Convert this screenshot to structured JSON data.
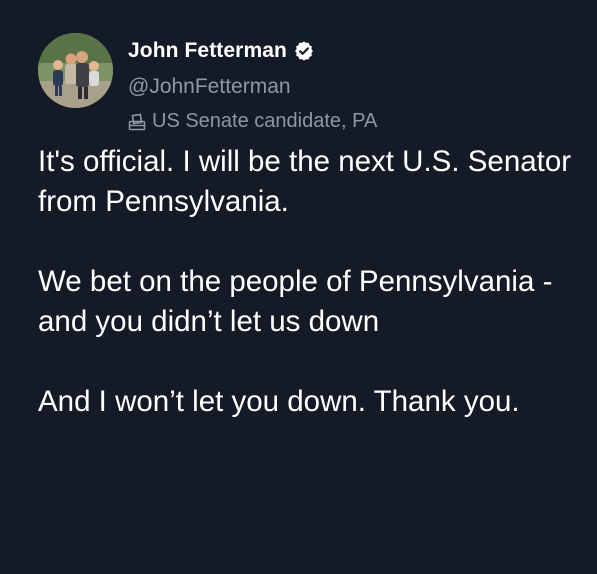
{
  "author": {
    "display_name": "John Fetterman",
    "handle": "@JohnFetterman",
    "verified": true,
    "label": "US Senate candidate, PA",
    "avatar_icon": "profile-photo"
  },
  "tweet": {
    "paragraphs": [
      "It's official. I will be the next U.S. Senator from Pennsylvania.",
      "We bet on the people of Pennsylvania - and you didn’t let us down",
      "And I won’t let you down. Thank you."
    ]
  },
  "colors": {
    "background": "#151b26",
    "text": "#ffffff",
    "secondary_text": "#8b98a5",
    "verified_badge": "#ffffff"
  }
}
